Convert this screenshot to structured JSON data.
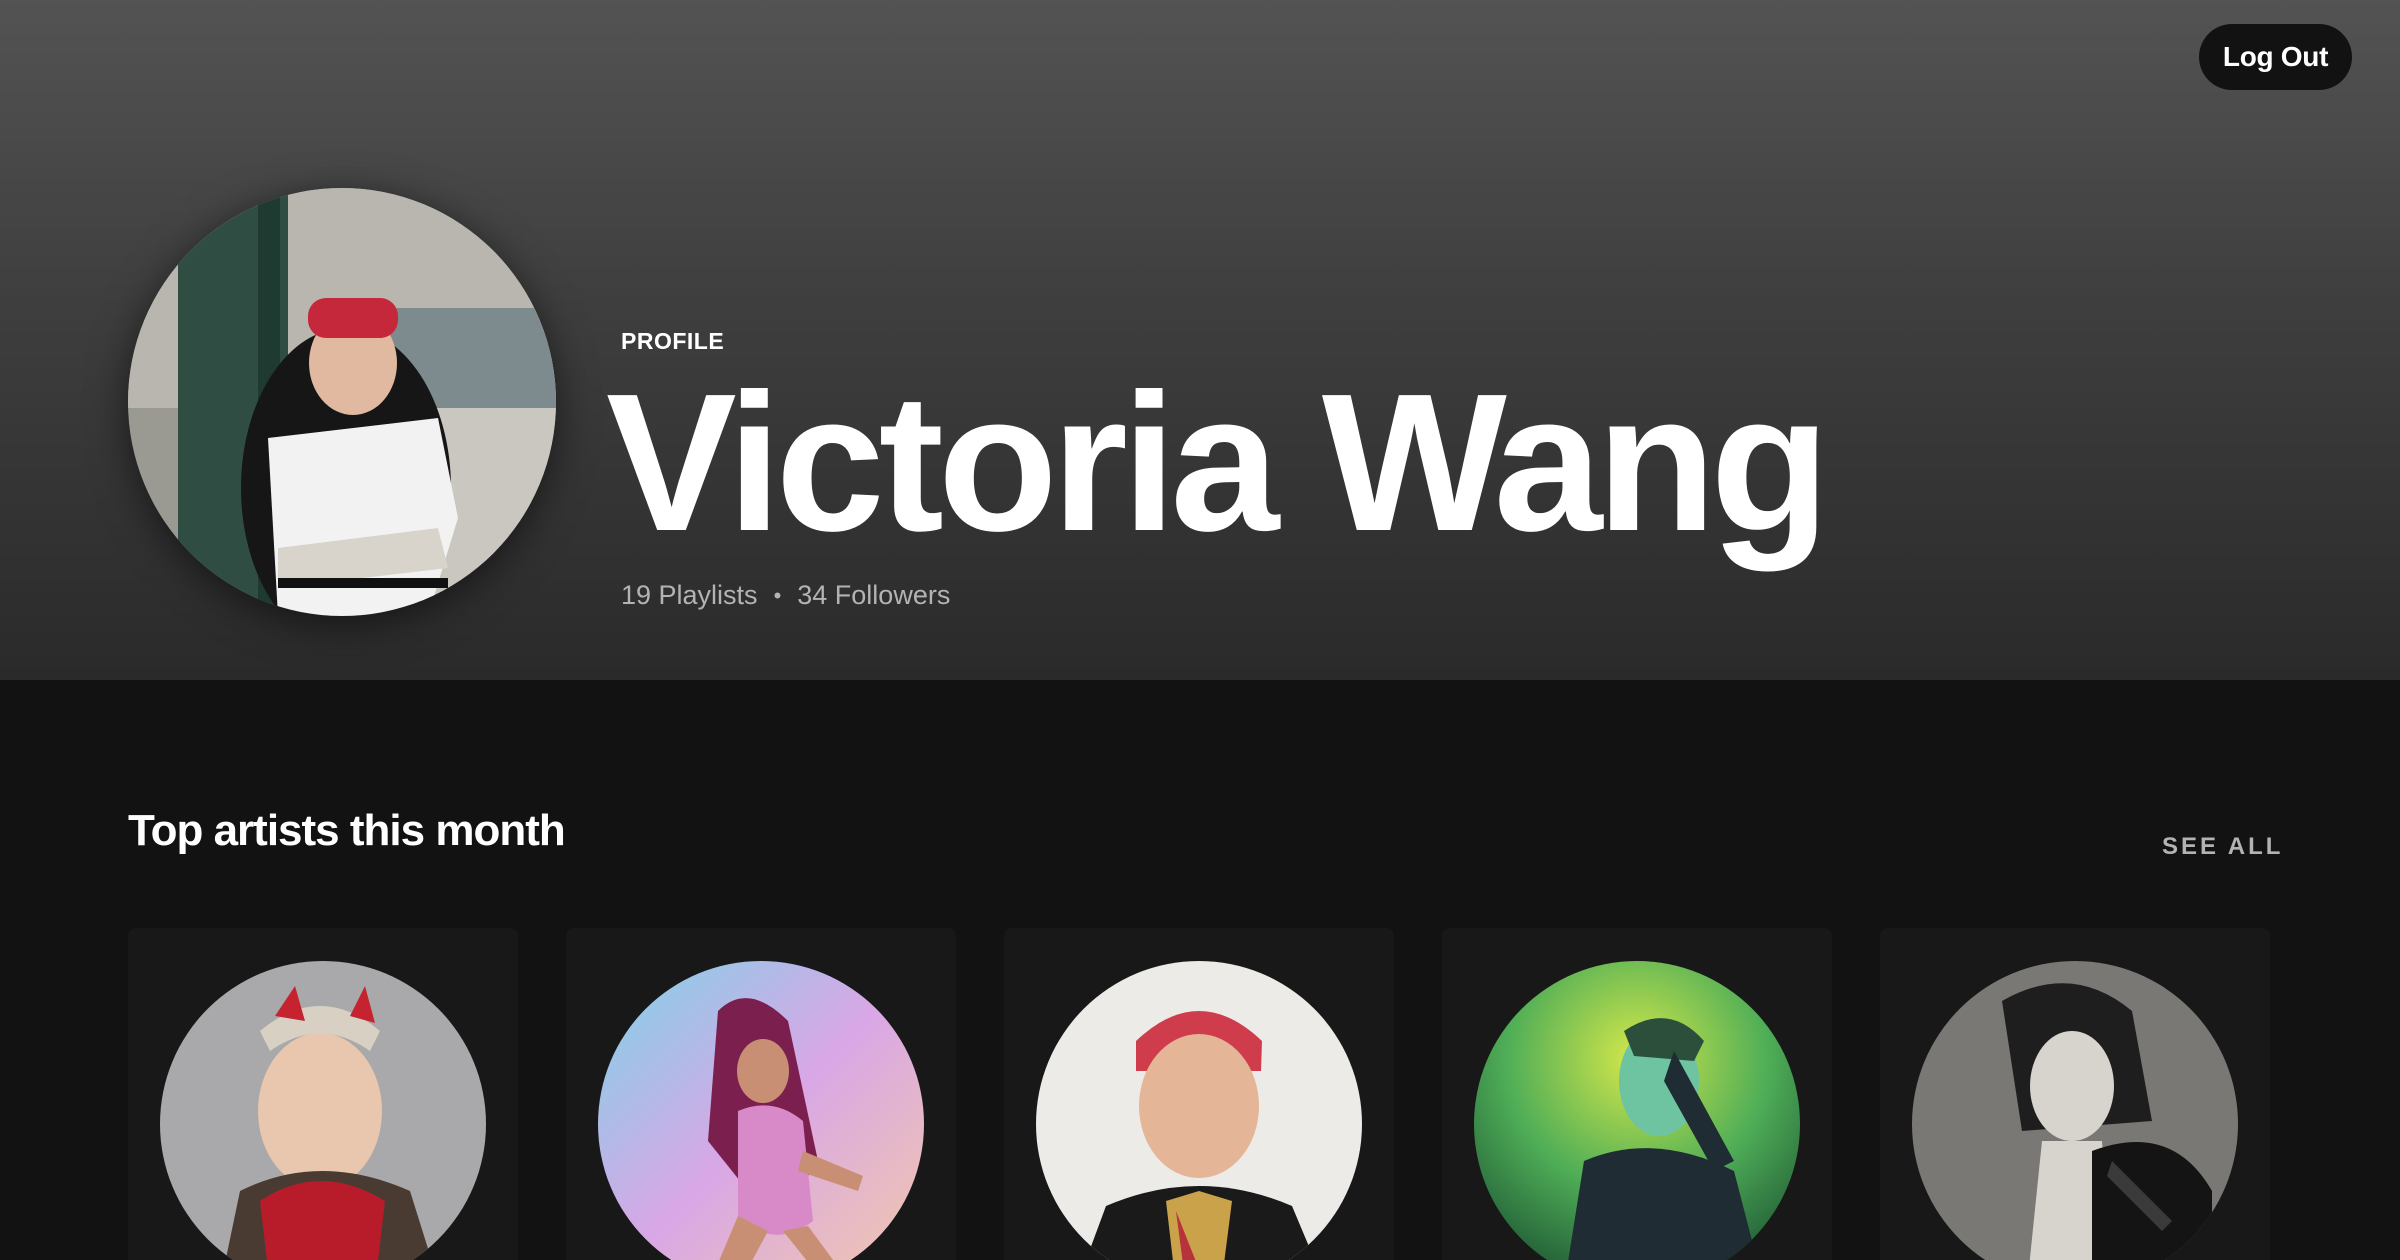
{
  "header": {
    "logout_label": "Log Out",
    "profile_label": "PROFILE",
    "display_name": "Victoria Wang",
    "playlists": "19 Playlists",
    "separator": "•",
    "followers": "34 Followers"
  },
  "top_artists": {
    "title": "Top artists this month",
    "see_all_label": "SEE ALL",
    "items": [
      {
        "icon": "artist-photo-1"
      },
      {
        "icon": "artist-photo-2"
      },
      {
        "icon": "artist-photo-3"
      },
      {
        "icon": "artist-photo-4"
      },
      {
        "icon": "artist-photo-5"
      }
    ]
  },
  "colors": {
    "background": "#121212",
    "card": "#181818",
    "header_top": "#535353",
    "text_secondary": "#b3b3b3"
  }
}
